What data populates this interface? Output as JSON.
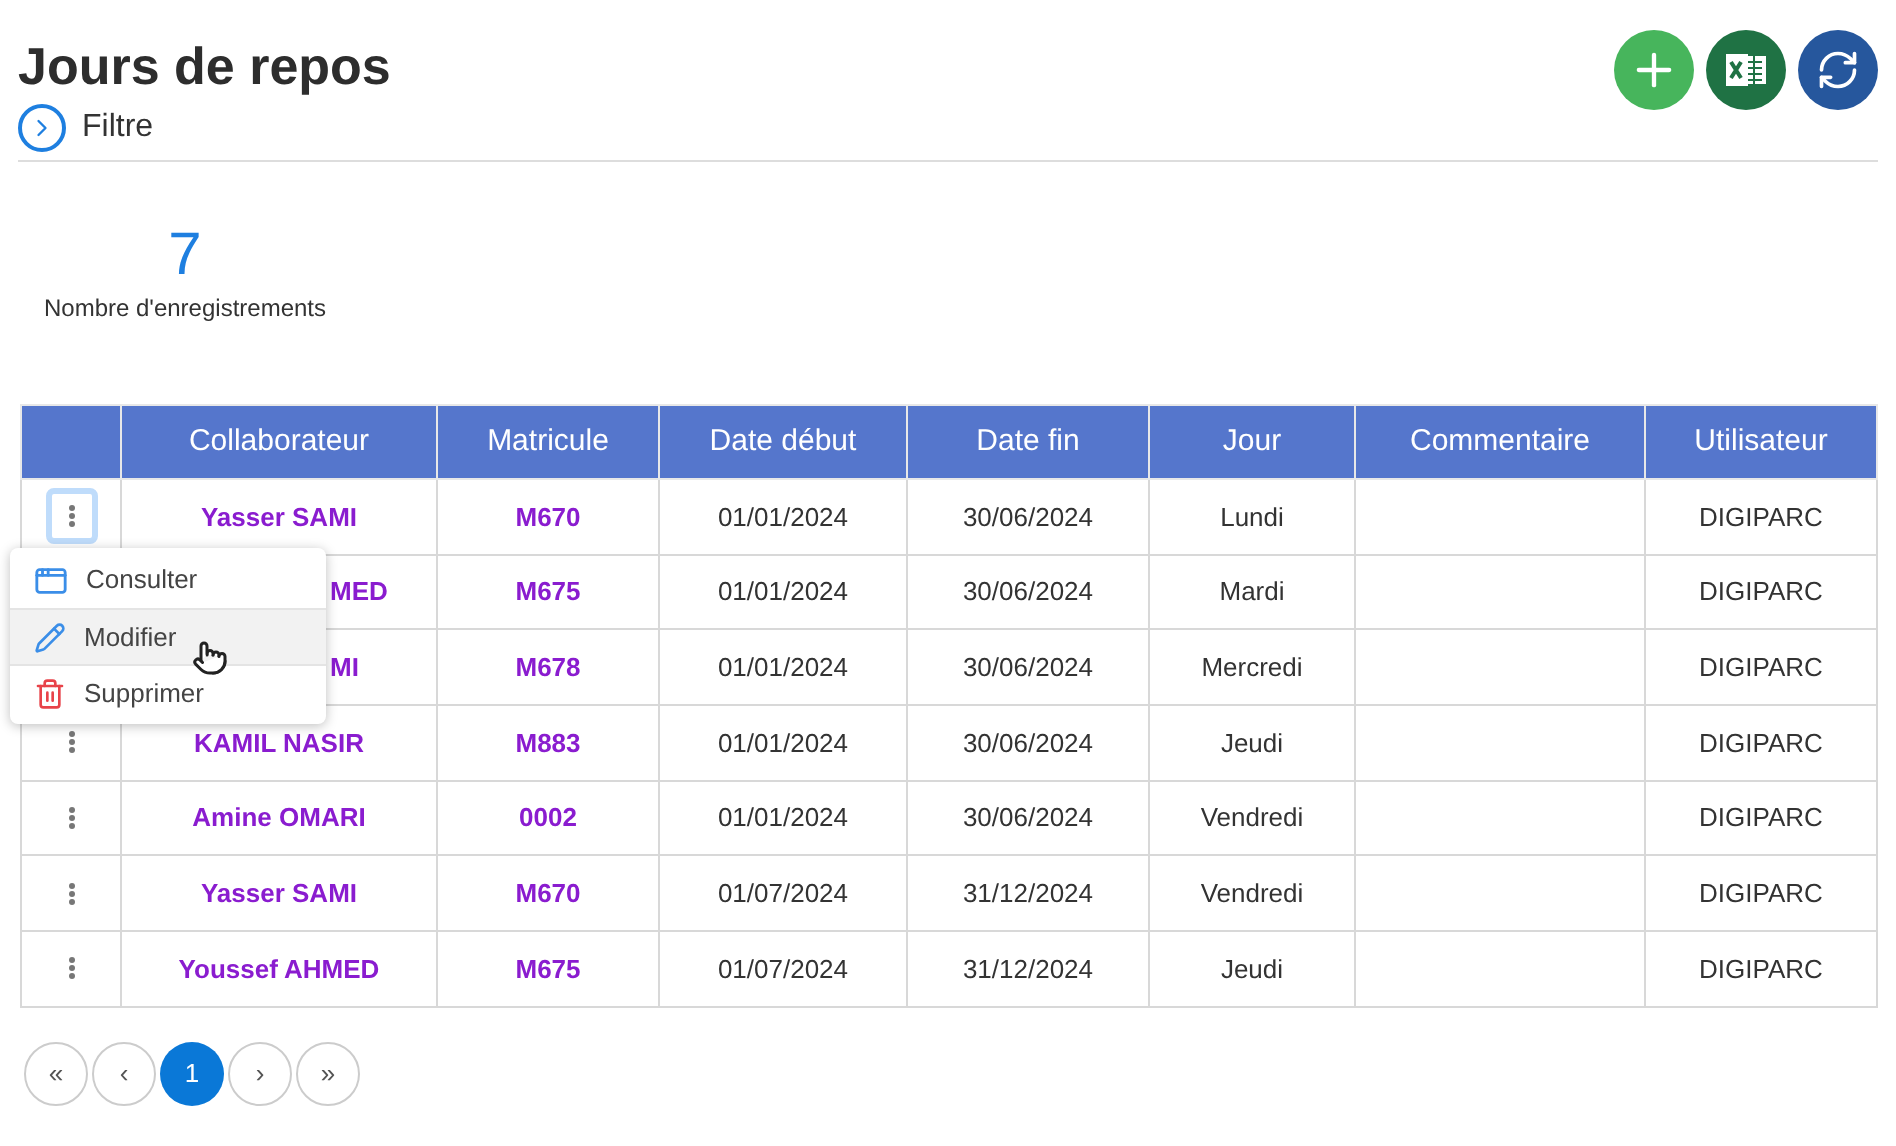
{
  "title": "Jours de repos",
  "filter": {
    "label": "Filtre",
    "expanded": false
  },
  "count": {
    "value": "7",
    "label": "Nombre d'enregistrements"
  },
  "table": {
    "columns": [
      "",
      "Collaborateur",
      "Matricule",
      "Date début",
      "Date fin",
      "Jour",
      "Commentaire",
      "Utilisateur"
    ],
    "rows": [
      {
        "focused": true,
        "collaborateur": "Yasser  SAMI",
        "partial": false,
        "matricule": "M670",
        "debut": "01/01/2024",
        "fin": "30/06/2024",
        "jour": "Lundi",
        "commentaire": "",
        "utilisateur": "DIGIPARC"
      },
      {
        "collaborateur": "MED",
        "partial": true,
        "matricule": "M675",
        "debut": "01/01/2024",
        "fin": "30/06/2024",
        "jour": "Mardi",
        "commentaire": "",
        "utilisateur": "DIGIPARC"
      },
      {
        "collaborateur": "MI",
        "partial": true,
        "matricule": "M678",
        "debut": "01/01/2024",
        "fin": "30/06/2024",
        "jour": "Mercredi",
        "commentaire": "",
        "utilisateur": "DIGIPARC"
      },
      {
        "focused": false,
        "collaborateur": "KAMIL NASIR",
        "partial": false,
        "matricule": "M883",
        "debut": "01/01/2024",
        "fin": "30/06/2024",
        "jour": "Jeudi",
        "commentaire": "",
        "utilisateur": "DIGIPARC"
      },
      {
        "focused": false,
        "collaborateur": "Amine OMARI",
        "partial": false,
        "matricule": "0002",
        "debut": "01/01/2024",
        "fin": "30/06/2024",
        "jour": "Vendredi",
        "commentaire": "",
        "utilisateur": "DIGIPARC"
      },
      {
        "focused": false,
        "collaborateur": "Yasser  SAMI",
        "partial": false,
        "matricule": "M670",
        "debut": "01/07/2024",
        "fin": "31/12/2024",
        "jour": "Vendredi",
        "commentaire": "",
        "utilisateur": "DIGIPARC"
      },
      {
        "focused": false,
        "collaborateur": "Youssef AHMED",
        "partial": false,
        "matricule": "M675",
        "debut": "01/07/2024",
        "fin": "31/12/2024",
        "jour": "Jeudi",
        "commentaire": "",
        "utilisateur": "DIGIPARC"
      }
    ]
  },
  "menu": [
    {
      "kind": "view",
      "label": "Consulter",
      "selected": false
    },
    {
      "kind": "edit",
      "label": "Modifier",
      "selected": true
    },
    {
      "kind": "delete",
      "label": "Supprimer",
      "selected": false
    }
  ],
  "pagination": [
    {
      "label": "«",
      "selected": false
    },
    {
      "label": "‹",
      "selected": false
    },
    {
      "label": "1",
      "selected": true
    },
    {
      "label": "›",
      "selected": false
    },
    {
      "label": "»",
      "selected": false
    }
  ]
}
